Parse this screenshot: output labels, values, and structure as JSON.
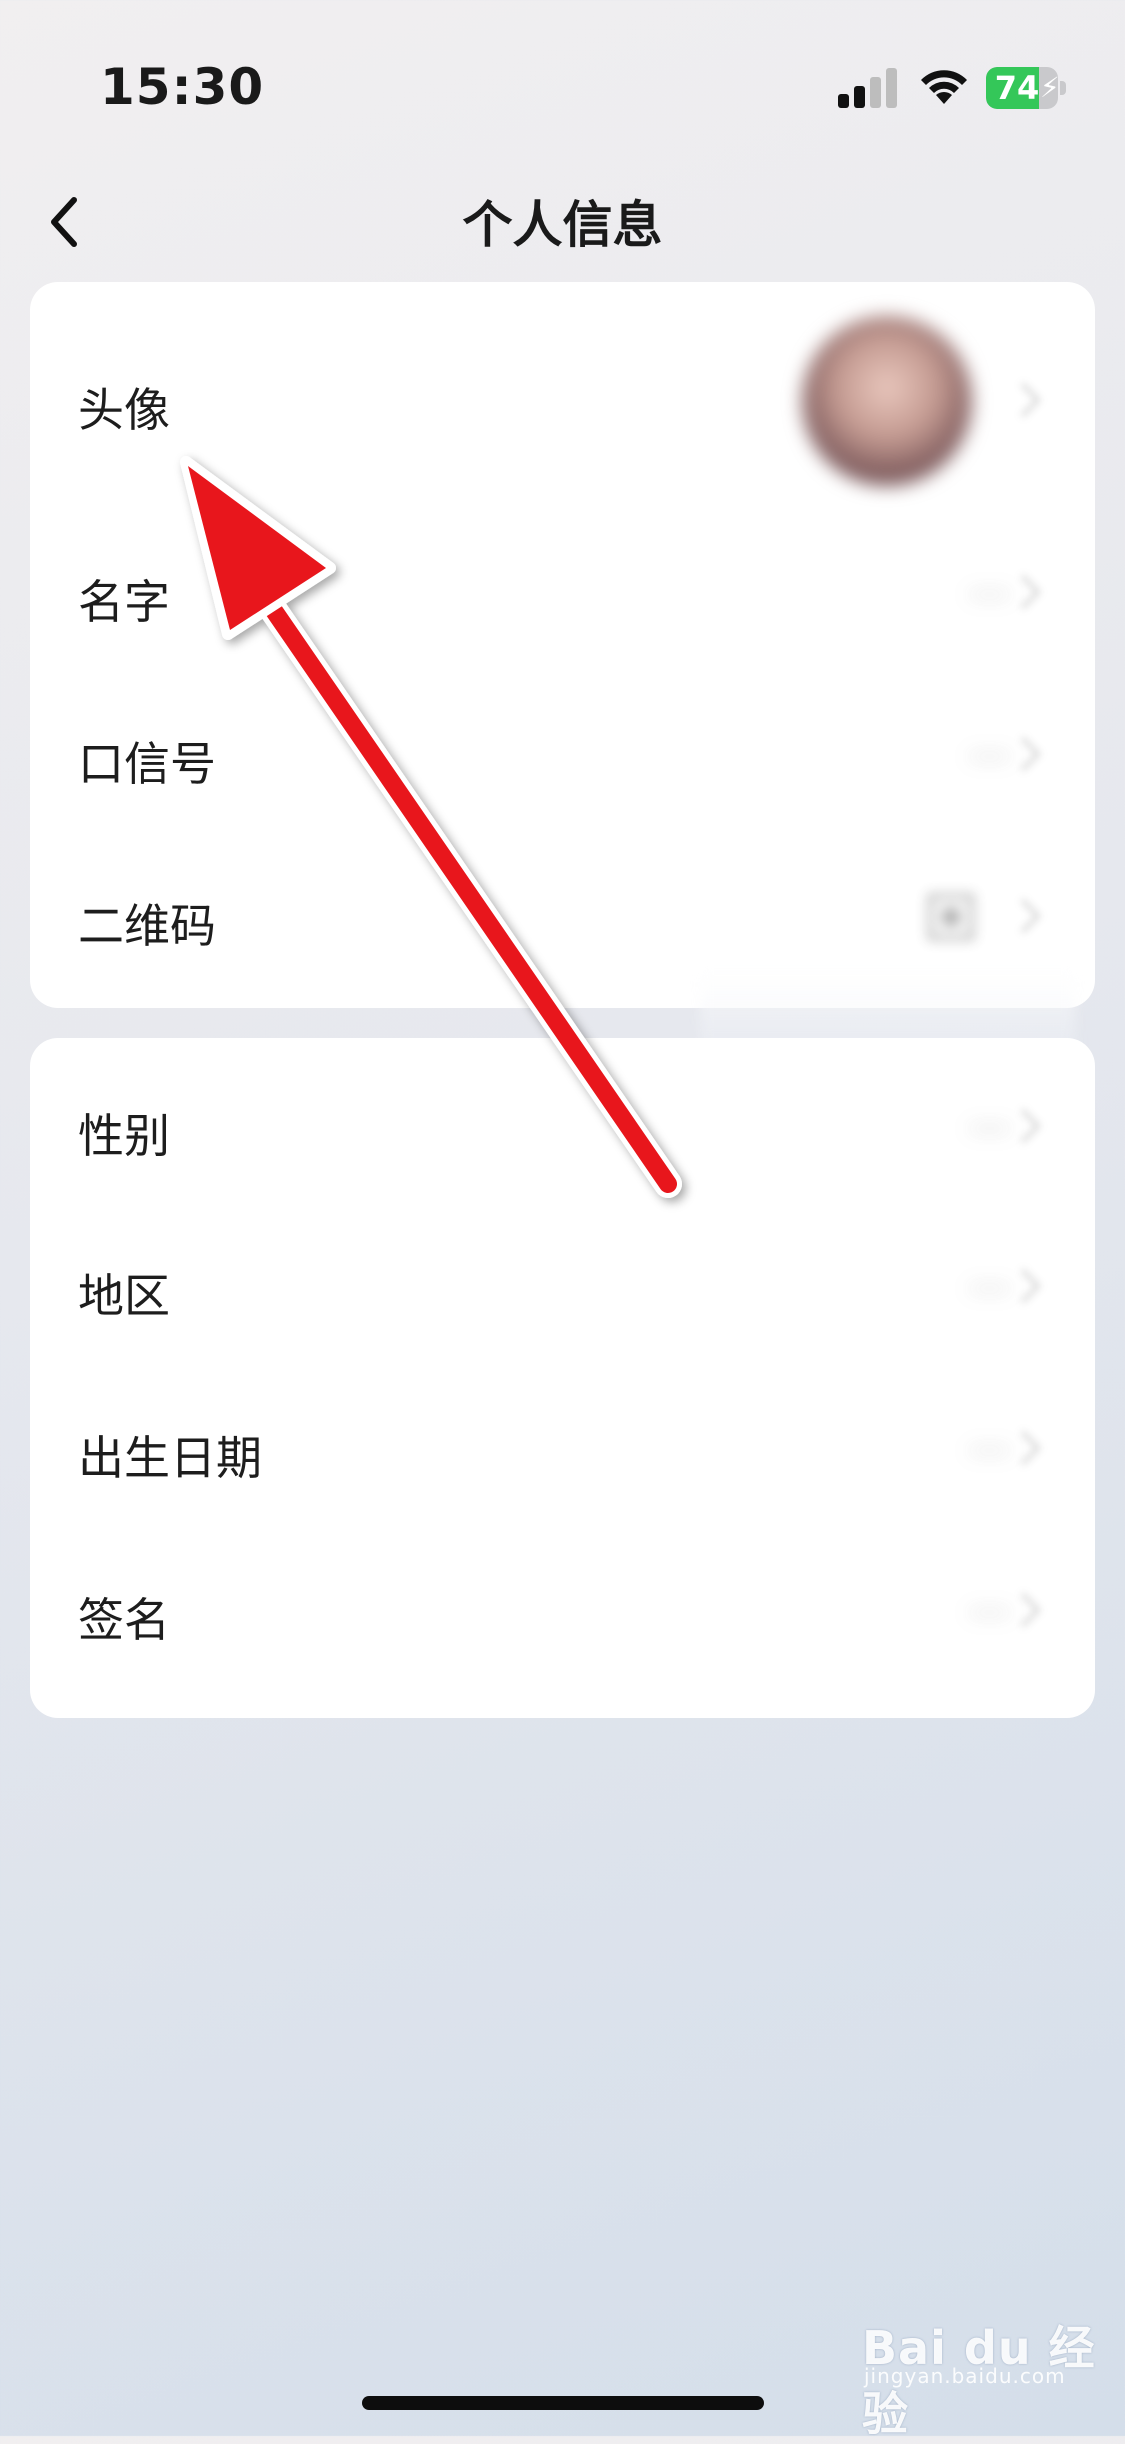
{
  "status_bar": {
    "time": "15:30",
    "battery_percent": "74",
    "battery_level": 0.74,
    "battery_color": "#34c759",
    "icons": [
      "signal-icon",
      "wifi-icon",
      "battery-icon"
    ]
  },
  "nav": {
    "title": "个人信息",
    "back_icon": "chevron-left-icon"
  },
  "section_1": {
    "rows": [
      {
        "label": "头像"
      },
      {
        "label": "名字",
        "value": "---"
      },
      {
        "label": "口信号",
        "value": "---"
      },
      {
        "label": "二维码"
      }
    ]
  },
  "section_2": {
    "rows": [
      {
        "label": "性别",
        "value": "---"
      },
      {
        "label": "地区",
        "value": "---"
      },
      {
        "label": "出生日期",
        "value": "---"
      },
      {
        "label": "签名",
        "value": "---"
      }
    ]
  },
  "annotation": {
    "color": "#e8141c"
  },
  "watermark": {
    "brand": "Bai du 经验",
    "url": "jingyan.baidu.com"
  }
}
